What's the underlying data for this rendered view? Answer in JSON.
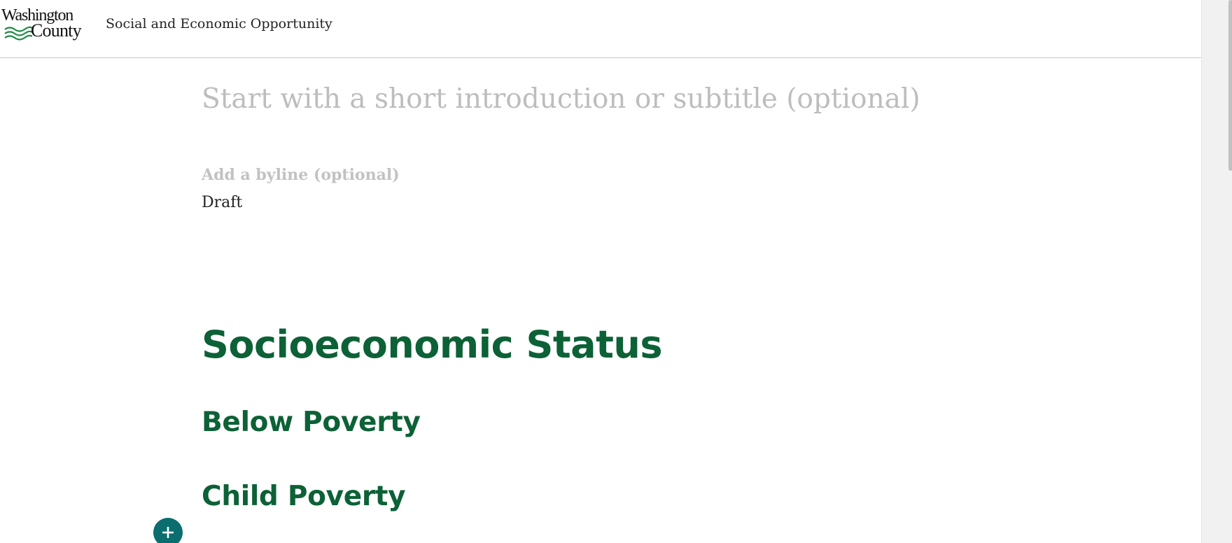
{
  "header": {
    "logo": {
      "line1": "Washington",
      "line2": "County"
    },
    "site_title": "Social and Economic Opportunity"
  },
  "story": {
    "subtitle_placeholder": "Start with a short introduction or subtitle (optional)",
    "byline_placeholder": "Add a byline (optional)",
    "status": "Draft"
  },
  "sections": {
    "main_heading": "Socioeconomic Status",
    "subheadings": [
      "Below Poverty",
      "Child Poverty"
    ]
  },
  "controls": {
    "add_block_icon": "plus-icon"
  },
  "colors": {
    "heading_green": "#0c6136",
    "logo_wave_green": "#1e8a45",
    "add_button_teal": "#0b6e6e",
    "placeholder_gray": "#bdbdbd"
  }
}
